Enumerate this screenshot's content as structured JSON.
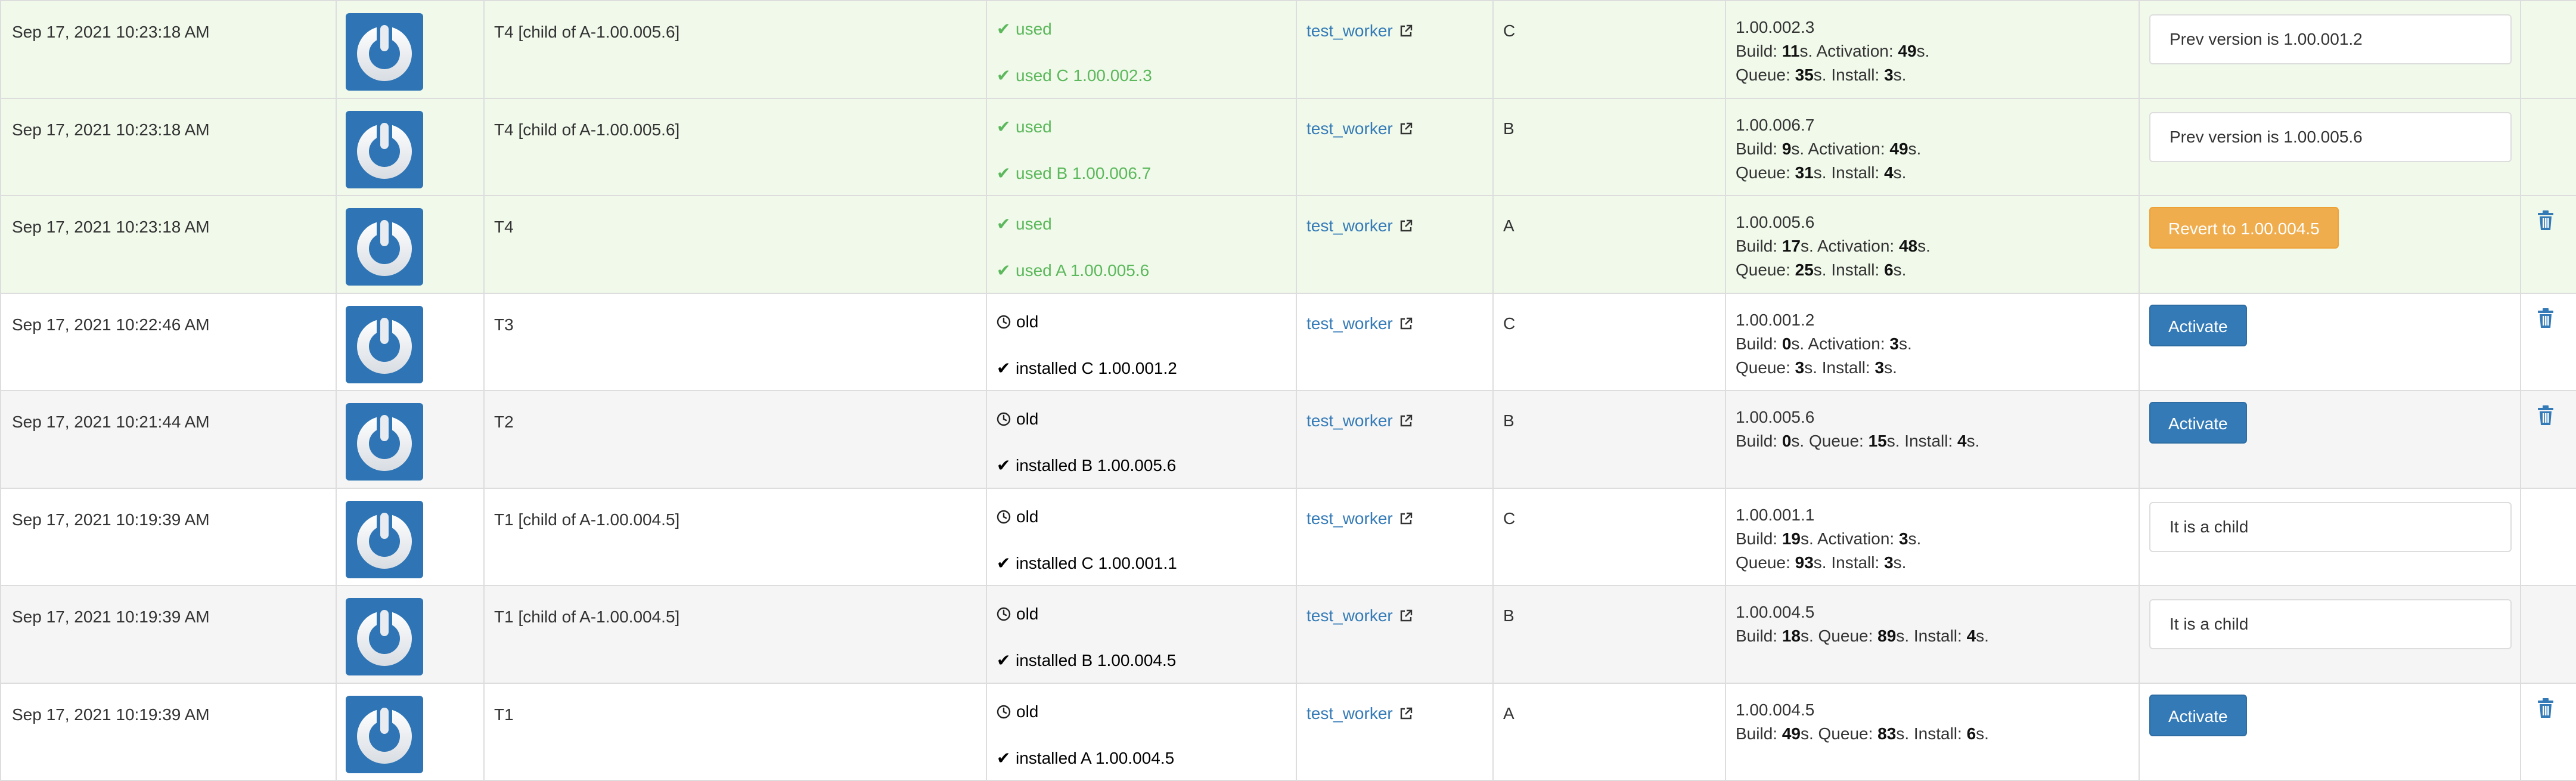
{
  "colors": {
    "used_row_bg": "#f0f9ea",
    "zebra_row_bg": "#f5f5f5",
    "link": "#337ab7",
    "success": "#5cb85c",
    "primary_button": "#337ab7",
    "warning_button": "#f0ad4e",
    "avatar_bg": "#2f75b5"
  },
  "rows": [
    {
      "style": "used",
      "date": "Sep 17, 2021 10:23:18 AM",
      "avatar": "power-icon",
      "name": "T4 [child of A-1.00.005.6]",
      "status_icon": "check-icon",
      "status": "used",
      "installed_icon": "check-icon",
      "installed": "used C 1.00.002.3",
      "worker": "test_worker",
      "slot": "C",
      "version": "1.00.002.3",
      "timing": [
        [
          "Build: ",
          "11",
          "s. Activation: ",
          "49",
          "s."
        ],
        [
          "Queue: ",
          "35",
          "s. Install: ",
          "3",
          "s."
        ]
      ],
      "action": {
        "kind": "note",
        "text": "Prev version is 1.00.001.2"
      },
      "delete": false
    },
    {
      "style": "used",
      "date": "Sep 17, 2021 10:23:18 AM",
      "avatar": "power-icon",
      "name": "T4 [child of A-1.00.005.6]",
      "status_icon": "check-icon",
      "status": "used",
      "installed_icon": "check-icon",
      "installed": "used B 1.00.006.7",
      "worker": "test_worker",
      "slot": "B",
      "version": "1.00.006.7",
      "timing": [
        [
          "Build: ",
          "9",
          "s. Activation: ",
          "49",
          "s."
        ],
        [
          "Queue: ",
          "31",
          "s. Install: ",
          "4",
          "s."
        ]
      ],
      "action": {
        "kind": "note",
        "text": "Prev version is 1.00.005.6"
      },
      "delete": false
    },
    {
      "style": "used",
      "date": "Sep 17, 2021 10:23:18 AM",
      "avatar": "power-icon",
      "name": "T4",
      "status_icon": "check-icon",
      "status": "used",
      "installed_icon": "check-icon",
      "installed": "used A 1.00.005.6",
      "worker": "test_worker",
      "slot": "A",
      "version": "1.00.005.6",
      "timing": [
        [
          "Build: ",
          "17",
          "s. Activation: ",
          "48",
          "s."
        ],
        [
          "Queue: ",
          "25",
          "s. Install: ",
          "6",
          "s."
        ]
      ],
      "action": {
        "kind": "button",
        "style": "warning",
        "text": "Revert to 1.00.004.5"
      },
      "delete": true
    },
    {
      "style": "plain",
      "date": "Sep 17, 2021 10:22:46 AM",
      "avatar": "power-icon",
      "name": "T3",
      "status_icon": "clock-icon",
      "status": "old",
      "installed_icon": "checkmark-icon",
      "installed": "installed C 1.00.001.2",
      "worker": "test_worker",
      "slot": "C",
      "version": "1.00.001.2",
      "timing": [
        [
          "Build: ",
          "0",
          "s. Activation: ",
          "3",
          "s."
        ],
        [
          "Queue: ",
          "3",
          "s. Install: ",
          "3",
          "s."
        ]
      ],
      "action": {
        "kind": "button",
        "style": "primary",
        "text": "Activate"
      },
      "delete": true
    },
    {
      "style": "zebra",
      "date": "Sep 17, 2021 10:21:44 AM",
      "avatar": "power-icon",
      "name": "T2",
      "status_icon": "clock-icon",
      "status": "old",
      "installed_icon": "checkmark-icon",
      "installed": "installed B 1.00.005.6",
      "worker": "test_worker",
      "slot": "B",
      "version": "1.00.005.6",
      "timing": [
        [
          "Build: ",
          "0",
          "s. Queue: ",
          "15",
          "s. Install: ",
          "4",
          "s."
        ]
      ],
      "action": {
        "kind": "button",
        "style": "primary",
        "text": "Activate"
      },
      "delete": true
    },
    {
      "style": "plain",
      "date": "Sep 17, 2021 10:19:39 AM",
      "avatar": "power-icon",
      "name": "T1 [child of A-1.00.004.5]",
      "status_icon": "clock-icon",
      "status": "old",
      "installed_icon": "checkmark-icon",
      "installed": "installed C 1.00.001.1",
      "worker": "test_worker",
      "slot": "C",
      "version": "1.00.001.1",
      "timing": [
        [
          "Build: ",
          "19",
          "s. Activation: ",
          "3",
          "s."
        ],
        [
          "Queue: ",
          "93",
          "s. Install: ",
          "3",
          "s."
        ]
      ],
      "action": {
        "kind": "note",
        "text": "It is a child"
      },
      "delete": false
    },
    {
      "style": "zebra",
      "date": "Sep 17, 2021 10:19:39 AM",
      "avatar": "power-icon",
      "name": "T1 [child of A-1.00.004.5]",
      "status_icon": "clock-icon",
      "status": "old",
      "installed_icon": "checkmark-icon",
      "installed": "installed B 1.00.004.5",
      "worker": "test_worker",
      "slot": "B",
      "version": "1.00.004.5",
      "timing": [
        [
          "Build: ",
          "18",
          "s. Queue: ",
          "89",
          "s. Install: ",
          "4",
          "s."
        ]
      ],
      "action": {
        "kind": "note",
        "text": "It is a child"
      },
      "delete": false
    },
    {
      "style": "plain",
      "date": "Sep 17, 2021 10:19:39 AM",
      "avatar": "power-icon",
      "name": "T1",
      "status_icon": "clock-icon",
      "status": "old",
      "installed_icon": "checkmark-icon",
      "installed": "installed A 1.00.004.5",
      "worker": "test_worker",
      "slot": "A",
      "version": "1.00.004.5",
      "timing": [
        [
          "Build: ",
          "49",
          "s. Queue: ",
          "83",
          "s. Install: ",
          "6",
          "s."
        ]
      ],
      "action": {
        "kind": "button",
        "style": "primary",
        "text": "Activate"
      },
      "delete": true
    }
  ]
}
